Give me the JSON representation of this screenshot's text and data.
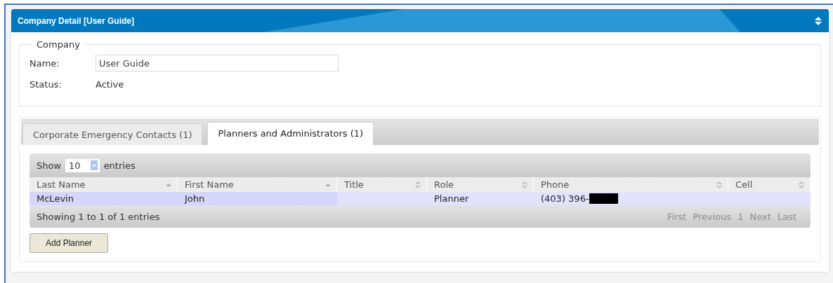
{
  "panel": {
    "title": "Company Detail [User Guide]"
  },
  "company": {
    "legend": "Company",
    "name_label": "Name:",
    "name_value": "User Guide",
    "status_label": "Status:",
    "status_value": "Active"
  },
  "tabs": [
    {
      "label": "Corporate Emergency Contacts (1)",
      "selected": false
    },
    {
      "label": "Planners and Administrators (1)",
      "selected": true
    }
  ],
  "table": {
    "show_label": "Show",
    "page_size": "10",
    "entries_label": "entries",
    "columns": [
      {
        "label": "Last Name",
        "sorted": true
      },
      {
        "label": "First Name",
        "sorted": true
      },
      {
        "label": "Title",
        "sorted": false
      },
      {
        "label": "Role",
        "sorted": false
      },
      {
        "label": "Phone",
        "sorted": false
      },
      {
        "label": "Cell",
        "sorted": false
      }
    ],
    "rows": [
      {
        "cells": [
          {
            "text": "McLevin",
            "redacted": false
          },
          {
            "text": "John",
            "redacted": false
          },
          {
            "redacted": false
          },
          {
            "text": "Planner",
            "redacted": false
          },
          {
            "text": "(403) 396-",
            "redacted": true
          },
          {
            "redacted": false
          }
        ]
      }
    ],
    "info": "Showing 1 to 1 of 1 entries",
    "pagination": [
      {
        "label": "First",
        "disabled": true
      },
      {
        "label": "Previous",
        "disabled": true
      },
      {
        "label": "1",
        "disabled": true
      },
      {
        "label": "Next",
        "disabled": true
      },
      {
        "label": "Last",
        "disabled": true
      }
    ]
  },
  "buttons": [
    "Add Planner"
  ]
}
